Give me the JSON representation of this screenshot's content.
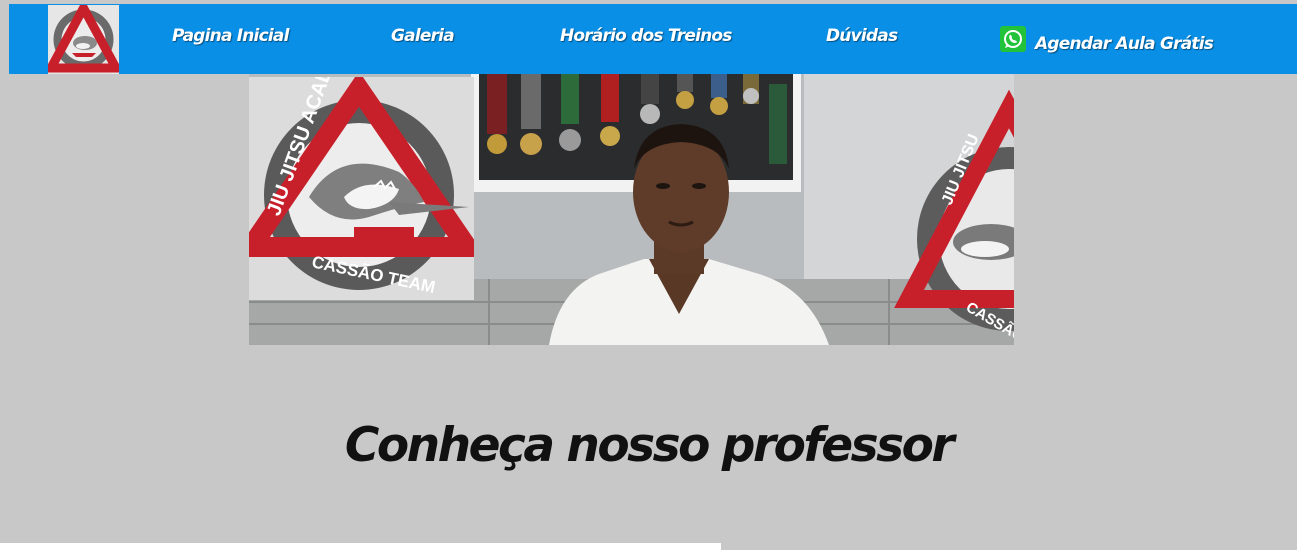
{
  "nav": {
    "logo_icon": "cassao-team-logo-icon",
    "items": [
      {
        "label": "Pagina Inicial"
      },
      {
        "label": "Galeria"
      },
      {
        "label": "Horário dos Treinos"
      },
      {
        "label": "Dúvidas"
      },
      {
        "label": "Agendar Aula Grátis",
        "icon": "whatsapp-icon"
      }
    ]
  },
  "hero": {
    "logo_top_text": "JIU JITSU ACADEMY",
    "logo_bottom_text": "CASSÃO TEAM",
    "wall_logo_top_text": "JIU JITSU",
    "wall_logo_bottom_text": "CASSÃO TEAM"
  },
  "section": {
    "title": "Conheça nosso professor"
  },
  "colors": {
    "nav_bg": "#0a8fe6",
    "page_bg": "#c8c8c8",
    "logo_red": "#c8202a",
    "whatsapp_green": "#22c33b"
  }
}
